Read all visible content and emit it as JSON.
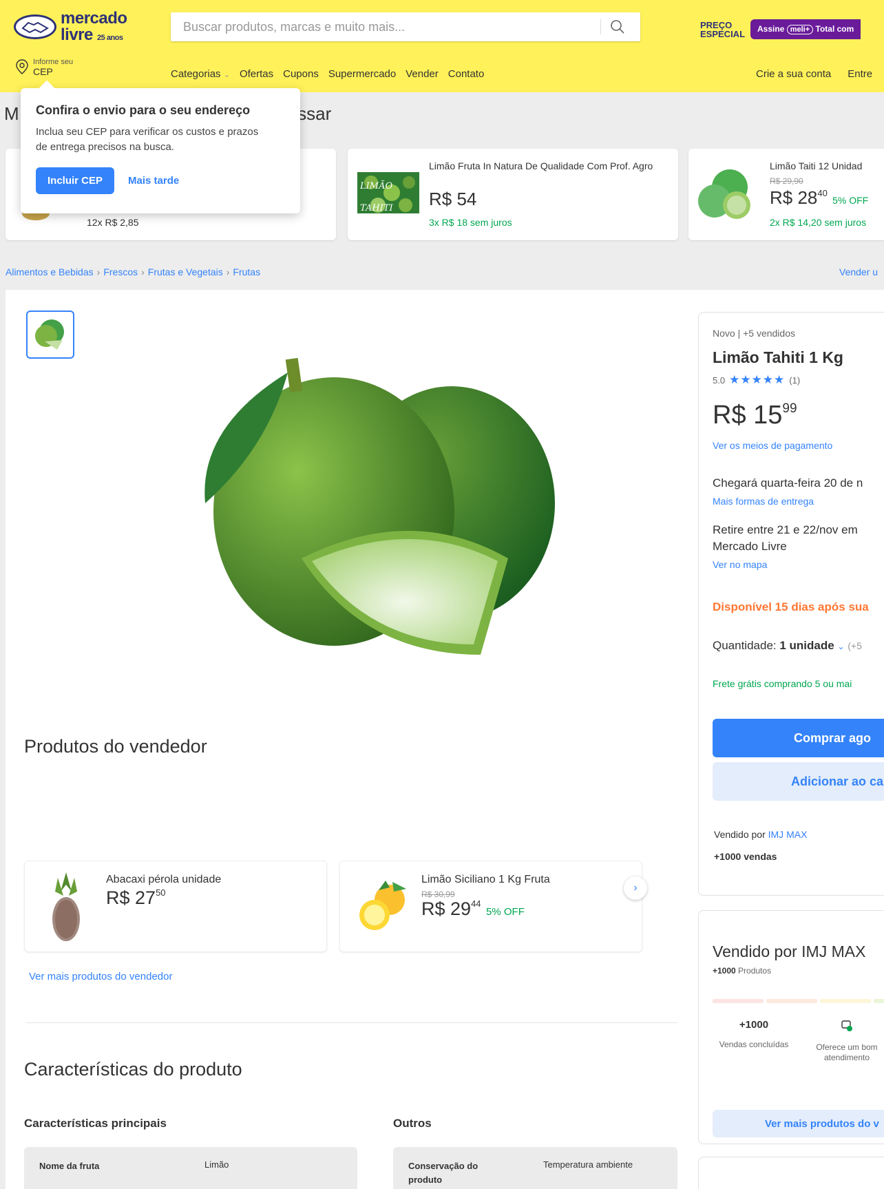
{
  "header": {
    "logo_line1": "mercado",
    "logo_line2": "livre",
    "logo_badge": "25 anos",
    "search_placeholder": "Buscar produtos, marcas e muito mais...",
    "promo_line1": "PREÇO",
    "promo_line2": "ESPECIAL",
    "promo_assine": "Assine",
    "promo_meli": "meli+",
    "promo_total": "Total com",
    "cep_line1": "Informe seu",
    "cep_line2": "CEP",
    "nav": [
      "Categorias",
      "Ofertas",
      "Cupons",
      "Supermercado",
      "Vender",
      "Contato"
    ],
    "account": "Crie a sua conta",
    "login": "Entre"
  },
  "popover": {
    "title": "Confira o envio para o seu endereço",
    "body": "Inclua seu CEP para verificar os custos e prazos de entrega precisos na busca.",
    "primary": "Incluir CEP",
    "secondary": "Mais tarde"
  },
  "recs": {
    "section_title_start": "M",
    "section_title_end": "essar",
    "items": [
      {
        "installments": "12x R$ 2,85"
      },
      {
        "title": "Limão Fruta In Natura De Qualidade Com Prof. Agro",
        "price": "R$ 54",
        "installments": "3x R$ 18 sem juros",
        "img_label_1": "LIMÃO",
        "img_label_2": "TAHITI"
      },
      {
        "title": "Limão Taiti 12 Unidad",
        "old_price": "R$ 29,90",
        "price": "R$ 28",
        "cents": "40",
        "discount": "5% OFF",
        "installments": "2x R$ 14,20 sem juros"
      }
    ]
  },
  "breadcrumb": [
    "Alimentos e Bebidas",
    "Frescos",
    "Frutas e Vegetais",
    "Frutas"
  ],
  "vender": "Vender u",
  "product": {
    "condition": "Novo  |  +5 vendidos",
    "title": "Limão Tahiti 1 Kg",
    "rating": "5.0",
    "stars": "★★★★★",
    "rating_count": "(1)",
    "price_int": "R$ 15",
    "price_cents": "99",
    "payment_link": "Ver os meios de pagamento",
    "delivery": "Chegará quarta-feira 20 de n",
    "delivery_link": "Mais formas de entrega",
    "pickup_line1": "Retire entre 21 e 22/nov em",
    "pickup_line2": "Mercado Livre",
    "map_link": "Ver no mapa",
    "availability": "Disponível 15 dias após sua",
    "qty_label": "Quantidade: ",
    "qty_value": "1 unidade",
    "qty_more": "(+5",
    "free_shipping": "Frete grátis comprando 5 ou mai",
    "buy_button": "Comprar ago",
    "cart_button": "Adicionar ao car",
    "sold_by_label": "Vendido por ",
    "sold_by_name": "IMJ MAX",
    "sales": "+1000 vendas"
  },
  "seller_products": {
    "title": "Produtos do vendedor",
    "items": [
      {
        "title": "Abacaxi pérola unidade",
        "price": "R$ 27",
        "cents": "50"
      },
      {
        "title": "Limão Siciliano 1 Kg Fruta",
        "old_price": "R$ 30,99",
        "price": "R$ 29",
        "cents": "44",
        "discount": "5% OFF"
      }
    ],
    "see_more": "Ver mais produtos do vendedor"
  },
  "characteristics": {
    "title": "Características do produto",
    "main_title": "Características principais",
    "other_title": "Outros",
    "main_rows": [
      {
        "key": "Nome da fruta",
        "value": "Limão"
      }
    ],
    "other_rows": [
      {
        "key": "Conservação do produto",
        "value": "Temperatura ambiente"
      }
    ]
  },
  "seller_box": {
    "title": "Vendido por IMJ MAX",
    "products_count": "+1000",
    "products_label": " Produtos",
    "stat1_value": "+1000",
    "stat1_label": "Vendas concluídas",
    "stat2_label_1": "Oferece um bom",
    "stat2_label_2": "atendimento",
    "button": "Ver mais produtos do v"
  },
  "colors": {
    "brand_yellow": "#fff159",
    "accent_blue": "#3483fa",
    "success_green": "#00a650",
    "warning_orange": "#ff7733"
  }
}
